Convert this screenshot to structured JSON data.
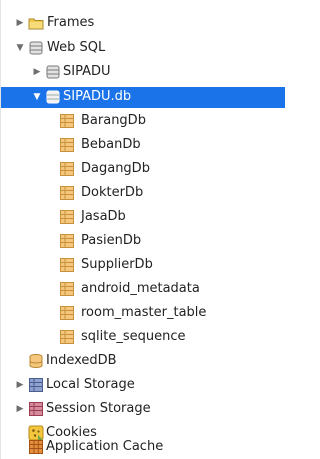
{
  "tree": {
    "frames": {
      "label": "Frames",
      "expanded": false,
      "icon": "folder-icon"
    },
    "websql": {
      "label": "Web SQL",
      "expanded": true,
      "icon": "database-icon"
    },
    "sipadu": {
      "label": "SIPADU",
      "expanded": false,
      "icon": "database-icon"
    },
    "sipadu_db": {
      "label": "SIPADU.db",
      "expanded": true,
      "selected": true,
      "icon": "database-icon",
      "tables": [
        {
          "label": "BarangDb"
        },
        {
          "label": "BebanDb"
        },
        {
          "label": "DagangDb"
        },
        {
          "label": "DokterDb"
        },
        {
          "label": "JasaDb"
        },
        {
          "label": "PasienDb"
        },
        {
          "label": "SupplierDb"
        },
        {
          "label": "android_metadata"
        },
        {
          "label": "room_master_table"
        },
        {
          "label": "sqlite_sequence"
        }
      ]
    },
    "indexeddb": {
      "label": "IndexedDB",
      "icon": "database-icon"
    },
    "local_storage": {
      "label": "Local Storage",
      "expanded": false,
      "icon": "storage-grid-icon"
    },
    "session_storage": {
      "label": "Session Storage",
      "expanded": false,
      "icon": "storage-grid-icon"
    },
    "cookies": {
      "label": "Cookies",
      "icon": "cookie-icon"
    },
    "app_cache": {
      "label": "Application Cache",
      "icon": "app-cache-grid-icon"
    }
  },
  "colors": {
    "selection": "#1a73e8",
    "folder": "#f2c94c",
    "table": "#f5c77e",
    "local_storage": "#6a7fb5",
    "session_storage": "#c0607a",
    "app_cache": "#d97b2b"
  }
}
